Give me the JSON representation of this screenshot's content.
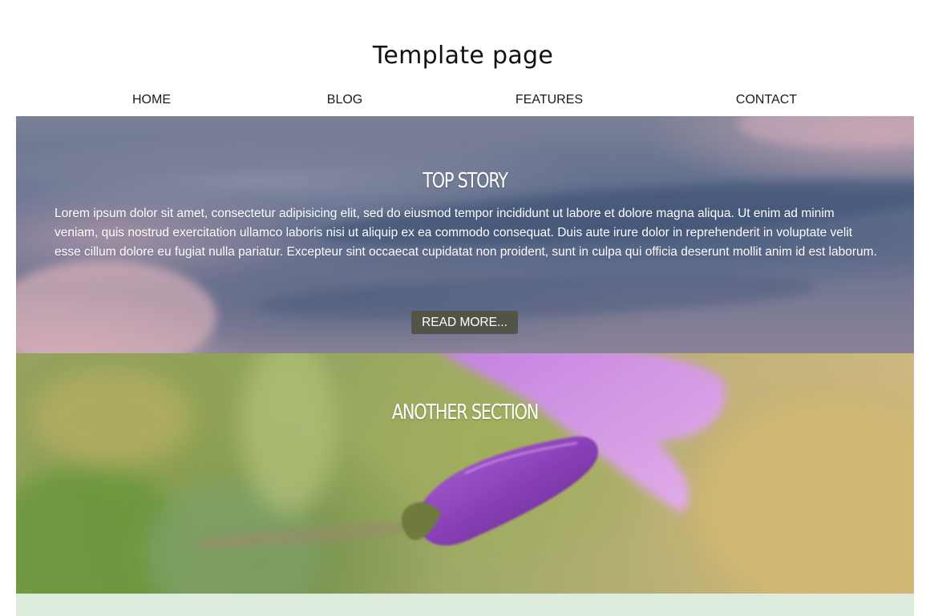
{
  "site": {
    "title": "Template page"
  },
  "nav": {
    "items": [
      {
        "label": "HOME"
      },
      {
        "label": "BLOG"
      },
      {
        "label": "FEATURES"
      },
      {
        "label": "CONTACT"
      }
    ]
  },
  "hero": {
    "title": "TOP STORY",
    "body": "Lorem ipsum dolor sit amet, consectetur adipisicing elit, sed do eiusmod tempor incididunt ut labore et dolore magna aliqua. Ut enim ad minim veniam, quis nostrud exercitation ullamco laboris nisi ut aliquip ex ea commodo consequat. Duis aute irure dolor in reprehenderit in voluptate velit esse cillum dolore eu fugiat nulla pariatur. Excepteur sint occaecat cupidatat non proident, sunt in culpa qui officia deserunt mollit anim id est laborum.",
    "button_label": "READ MORE..."
  },
  "another_section": {
    "title": "ANOTHER SECTION"
  },
  "colors": {
    "button_bg": "#535448",
    "footer_band": "#dcebdc",
    "flower_purple": "#a45ad0"
  }
}
